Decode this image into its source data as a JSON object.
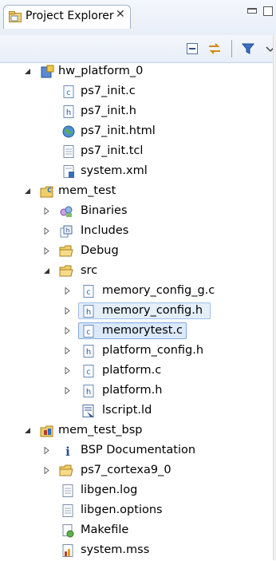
{
  "view": {
    "tab_title": "Project Explorer",
    "tab_close_glyph": "✕"
  },
  "toolbar": {
    "buttons": [
      "collapse-all-icon",
      "link-with-editor-icon",
      "filter-icon",
      "view-menu-icon"
    ]
  },
  "tree": {
    "hw_platform": {
      "label": "hw_platform_0",
      "children": [
        "ps7_init.c",
        "ps7_init.h",
        "ps7_init.html",
        "ps7_init.tcl",
        "system.xml"
      ]
    },
    "mem_test": {
      "label": "mem_test",
      "children": [
        "Binaries",
        "Includes",
        "Debug",
        "src"
      ],
      "src_children": [
        "memory_config_g.c",
        "memory_config.h",
        "memorytest.c",
        "platform_config.h",
        "platform.c",
        "platform.h",
        "lscript.ld"
      ]
    },
    "bsp": {
      "label": "mem_test_bsp",
      "children": [
        "BSP Documentation",
        "ps7_cortexa9_0",
        "libgen.log",
        "libgen.options",
        "Makefile",
        "system.mss"
      ]
    },
    "selected_item": "memorytest.c"
  },
  "colors": {
    "selection_bg": "#dbe9fa",
    "selection_border": "#7fa9dc",
    "folder": "#e8b84a",
    "c_source": "#2a6fb8"
  }
}
